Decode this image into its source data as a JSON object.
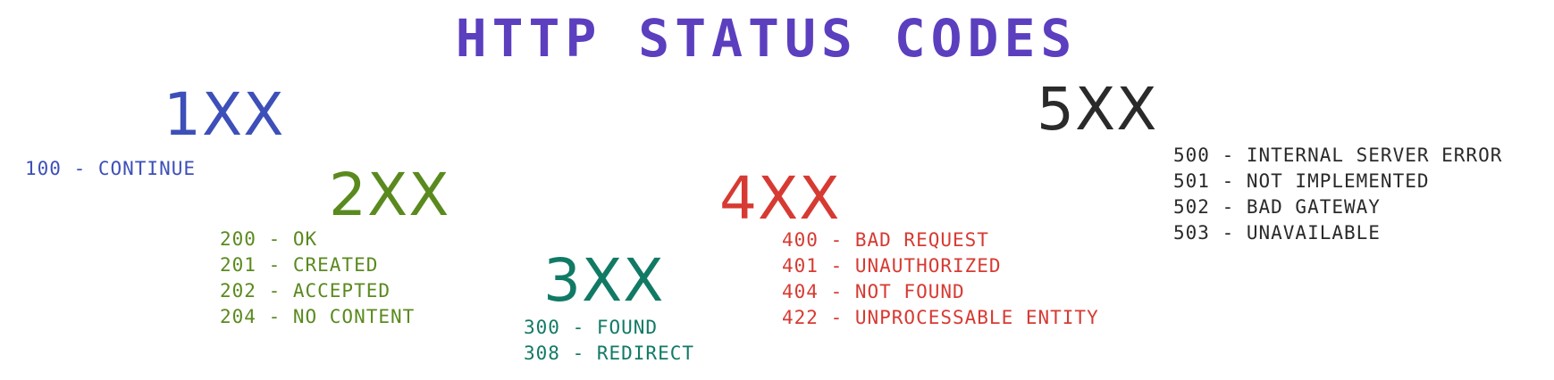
{
  "title": "HTTP STATUS CODES",
  "colors": {
    "title": "#5b3fbf",
    "1xx": "#3d4fb8",
    "2xx": "#5a8a1e",
    "3xx": "#117a65",
    "4xx": "#d63a32",
    "5xx": "#2a2a2a"
  },
  "groups": [
    {
      "key": "1xx",
      "heading": "1XX",
      "codes": [
        "100 - CONTINUE"
      ]
    },
    {
      "key": "2xx",
      "heading": "2XX",
      "codes": [
        "200 - OK",
        "201 - CREATED",
        "202 - ACCEPTED",
        "204 - NO CONTENT"
      ]
    },
    {
      "key": "3xx",
      "heading": "3XX",
      "codes": [
        "300 - FOUND",
        "308 - REDIRECT"
      ]
    },
    {
      "key": "4xx",
      "heading": "4XX",
      "codes": [
        "400 - BAD REQUEST",
        "401 - UNAUTHORIZED",
        "404 - NOT FOUND",
        "422 - UNPROCESSABLE ENTITY"
      ]
    },
    {
      "key": "5xx",
      "heading": "5XX",
      "codes": [
        "500 - INTERNAL SERVER ERROR",
        "501 - NOT IMPLEMENTED",
        "502 - BAD GATEWAY",
        "503 - UNAVAILABLE"
      ]
    }
  ]
}
